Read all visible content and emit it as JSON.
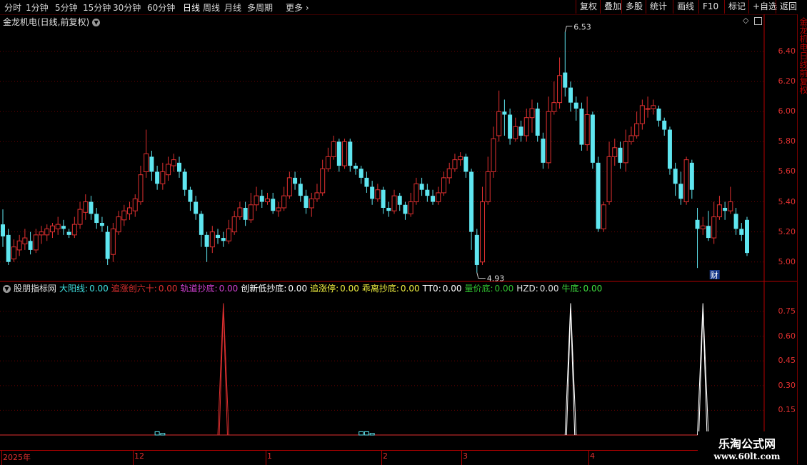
{
  "toolbar": {
    "timeframes": [
      "分时",
      "1分钟",
      "5分钟",
      "15分钟",
      "30分钟",
      "60分钟",
      "日线",
      "周线",
      "月线",
      "多周期",
      "更多"
    ],
    "active": "日线",
    "more_chevron": "chevron-right-icon",
    "right_buttons": [
      "复权",
      "叠加",
      "多股",
      "统计",
      "画线",
      "F10",
      "标记",
      "+自选",
      "返回"
    ]
  },
  "main": {
    "title": "金龙机电(日线,前复权)",
    "dropdown_icon": "chevron-down-icon",
    "diamond_icon": "diamond-icon",
    "panel_icon": "window-icon",
    "y_ticks": [
      "6.40",
      "6.20",
      "6.00",
      "5.80",
      "5.60",
      "5.40",
      "5.20",
      "5.00"
    ],
    "high_label": "6.53",
    "low_label": "4.93",
    "badge": "财"
  },
  "indicator": {
    "name": "股朋指标网",
    "items": [
      {
        "label": "大阳线:",
        "value": "0.00",
        "color": "#3fe0e0"
      },
      {
        "label": "追涨创六十:",
        "value": "0.00",
        "color": "#e03030"
      },
      {
        "label": "轨道抄底:",
        "value": "0.00",
        "color": "#d040d0"
      },
      {
        "label": "创新低抄底:",
        "value": "0.00",
        "color": "#ffffff"
      },
      {
        "label": "追涨停:",
        "value": "0.00",
        "color": "#f0f040"
      },
      {
        "label": "乖离抄底:",
        "value": "0.00",
        "color": "#f0f040"
      },
      {
        "label": "TT0:",
        "value": "0.00",
        "color": "#ffffff"
      },
      {
        "label": "量价底:",
        "value": "0.00",
        "color": "#30c030"
      },
      {
        "label": "HZD:",
        "value": "0.00",
        "color": "#e0e0e0"
      },
      {
        "label": "牛底:",
        "value": "0.00",
        "color": "#40e040"
      }
    ],
    "y_ticks": [
      "0.75",
      "0.60",
      "0.45",
      "0.30",
      "0.15"
    ]
  },
  "footer": {
    "dates": [
      "2025年",
      "12",
      "1",
      "2",
      "3",
      "4"
    ]
  },
  "watermark": {
    "line1": "乐淘公式网",
    "line2": "www.60lt.com"
  },
  "scroll_text": "金龙机电日线前复权",
  "chart_data": {
    "type": "candlestick",
    "ylim": [
      4.88,
      6.6
    ],
    "up_color": "#e03030",
    "down_color": "#5fe6f0",
    "candles": [
      [
        5.25,
        5.17,
        5.35,
        5.1
      ],
      [
        5.18,
        5.0,
        5.22,
        4.98
      ],
      [
        5.02,
        5.1,
        5.15,
        5.0
      ],
      [
        5.08,
        5.14,
        5.18,
        5.04
      ],
      [
        5.12,
        5.16,
        5.22,
        5.08
      ],
      [
        5.14,
        5.08,
        5.2,
        5.05
      ],
      [
        5.08,
        5.18,
        5.22,
        5.06
      ],
      [
        5.18,
        5.2,
        5.24,
        5.12
      ],
      [
        5.18,
        5.22,
        5.25,
        5.14
      ],
      [
        5.2,
        5.24,
        5.26,
        5.16
      ],
      [
        5.22,
        5.25,
        5.3,
        5.18
      ],
      [
        5.24,
        5.22,
        5.28,
        5.18
      ],
      [
        5.2,
        5.18,
        5.22,
        5.16
      ],
      [
        5.18,
        5.25,
        5.3,
        5.16
      ],
      [
        5.25,
        5.35,
        5.4,
        5.22
      ],
      [
        5.33,
        5.4,
        5.45,
        5.28
      ],
      [
        5.4,
        5.32,
        5.44,
        5.28
      ],
      [
        5.32,
        5.26,
        5.36,
        5.22
      ],
      [
        5.26,
        5.24,
        5.3,
        5.2
      ],
      [
        5.2,
        5.02,
        5.24,
        4.98
      ],
      [
        5.05,
        5.22,
        5.26,
        5.0
      ],
      [
        5.2,
        5.3,
        5.34,
        5.18
      ],
      [
        5.28,
        5.34,
        5.38,
        5.24
      ],
      [
        5.32,
        5.36,
        5.4,
        5.28
      ],
      [
        5.34,
        5.42,
        5.45,
        5.3
      ],
      [
        5.4,
        5.58,
        5.64,
        5.38
      ],
      [
        5.6,
        5.72,
        5.88,
        5.56
      ],
      [
        5.7,
        5.6,
        5.74,
        5.54
      ],
      [
        5.6,
        5.52,
        5.64,
        5.48
      ],
      [
        5.52,
        5.6,
        5.66,
        5.48
      ],
      [
        5.58,
        5.65,
        5.7,
        5.54
      ],
      [
        5.64,
        5.68,
        5.72,
        5.6
      ],
      [
        5.66,
        5.6,
        5.7,
        5.56
      ],
      [
        5.6,
        5.48,
        5.62,
        5.44
      ],
      [
        5.48,
        5.4,
        5.5,
        5.34
      ],
      [
        5.4,
        5.32,
        5.44,
        5.28
      ],
      [
        5.32,
        5.18,
        5.34,
        5.1
      ],
      [
        5.18,
        5.1,
        5.2,
        5.0
      ],
      [
        5.1,
        5.2,
        5.24,
        5.06
      ],
      [
        5.18,
        5.16,
        5.22,
        5.12
      ],
      [
        5.16,
        5.14,
        5.2,
        5.1
      ],
      [
        5.14,
        5.22,
        5.28,
        5.12
      ],
      [
        5.2,
        5.3,
        5.34,
        5.18
      ],
      [
        5.3,
        5.36,
        5.4,
        5.28
      ],
      [
        5.36,
        5.28,
        5.4,
        5.24
      ],
      [
        5.28,
        5.38,
        5.46,
        5.26
      ],
      [
        5.38,
        5.44,
        5.5,
        5.34
      ],
      [
        5.44,
        5.4,
        5.48,
        5.36
      ],
      [
        5.4,
        5.42,
        5.46,
        5.38
      ],
      [
        5.42,
        5.34,
        5.46,
        5.32
      ],
      [
        5.34,
        5.36,
        5.4,
        5.3
      ],
      [
        5.36,
        5.44,
        5.5,
        5.34
      ],
      [
        5.44,
        5.56,
        5.6,
        5.42
      ],
      [
        5.56,
        5.52,
        5.6,
        5.48
      ],
      [
        5.52,
        5.44,
        5.56,
        5.4
      ],
      [
        5.44,
        5.36,
        5.48,
        5.32
      ],
      [
        5.36,
        5.42,
        5.46,
        5.3
      ],
      [
        5.42,
        5.46,
        5.52,
        5.4
      ],
      [
        5.46,
        5.62,
        5.68,
        5.44
      ],
      [
        5.62,
        5.7,
        5.76,
        5.6
      ],
      [
        5.7,
        5.8,
        5.84,
        5.68
      ],
      [
        5.8,
        5.64,
        5.82,
        5.6
      ],
      [
        5.64,
        5.8,
        5.82,
        5.62
      ],
      [
        5.8,
        5.64,
        5.82,
        5.6
      ],
      [
        5.64,
        5.62,
        5.66,
        5.58
      ],
      [
        5.62,
        5.56,
        5.64,
        5.52
      ],
      [
        5.56,
        5.5,
        5.6,
        5.46
      ],
      [
        5.5,
        5.42,
        5.54,
        5.38
      ],
      [
        5.42,
        5.48,
        5.52,
        5.4
      ],
      [
        5.48,
        5.36,
        5.5,
        5.32
      ],
      [
        5.36,
        5.34,
        5.4,
        5.3
      ],
      [
        5.34,
        5.44,
        5.48,
        5.32
      ],
      [
        5.44,
        5.38,
        5.46,
        5.34
      ],
      [
        5.38,
        5.32,
        5.4,
        5.28
      ],
      [
        5.32,
        5.4,
        5.46,
        5.3
      ],
      [
        5.4,
        5.52,
        5.56,
        5.38
      ],
      [
        5.52,
        5.48,
        5.56,
        5.44
      ],
      [
        5.48,
        5.44,
        5.52,
        5.4
      ],
      [
        5.44,
        5.4,
        5.48,
        5.38
      ],
      [
        5.4,
        5.46,
        5.5,
        5.38
      ],
      [
        5.46,
        5.56,
        5.6,
        5.44
      ],
      [
        5.56,
        5.62,
        5.66,
        5.52
      ],
      [
        5.62,
        5.68,
        5.72,
        5.6
      ],
      [
        5.68,
        5.7,
        5.73,
        5.64
      ],
      [
        5.7,
        5.6,
        5.72,
        5.56
      ],
      [
        5.6,
        5.2,
        5.62,
        5.08
      ],
      [
        5.18,
        4.98,
        5.22,
        4.93
      ],
      [
        5.0,
        5.4,
        5.5,
        4.98
      ],
      [
        5.4,
        5.6,
        5.7,
        5.38
      ],
      [
        5.6,
        5.82,
        5.9,
        5.56
      ],
      [
        5.84,
        6.0,
        6.14,
        5.8
      ],
      [
        6.0,
        5.98,
        6.08,
        5.84
      ],
      [
        5.98,
        5.82,
        6.02,
        5.78
      ],
      [
        5.82,
        5.9,
        5.96,
        5.8
      ],
      [
        5.9,
        5.84,
        5.94,
        5.8
      ],
      [
        5.84,
        5.96,
        6.02,
        5.8
      ],
      [
        5.96,
        6.02,
        6.08,
        5.86
      ],
      [
        6.02,
        5.84,
        6.06,
        5.8
      ],
      [
        5.82,
        5.66,
        5.86,
        5.62
      ],
      [
        5.66,
        6.0,
        6.1,
        5.62
      ],
      [
        6.0,
        6.06,
        6.2,
        5.98
      ],
      [
        6.06,
        6.24,
        6.36,
        6.02
      ],
      [
        6.26,
        6.16,
        6.53,
        6.1
      ],
      [
        6.16,
        6.06,
        6.2,
        6.0
      ],
      [
        6.06,
        6.02,
        6.1,
        5.94
      ],
      [
        6.02,
        5.78,
        6.06,
        5.74
      ],
      [
        5.78,
        5.98,
        6.1,
        5.74
      ],
      [
        5.98,
        5.66,
        6.0,
        5.62
      ],
      [
        5.66,
        5.22,
        5.7,
        5.2
      ],
      [
        5.22,
        5.38,
        5.4,
        5.2
      ],
      [
        5.4,
        5.7,
        5.8,
        5.38
      ],
      [
        5.7,
        5.76,
        5.82,
        5.64
      ],
      [
        5.76,
        5.66,
        5.8,
        5.62
      ],
      [
        5.66,
        5.8,
        5.88,
        5.6
      ],
      [
        5.8,
        5.84,
        5.9,
        5.78
      ],
      [
        5.84,
        5.92,
        6.0,
        5.82
      ],
      [
        5.92,
        6.04,
        6.08,
        5.88
      ],
      [
        6.02,
        6.02,
        6.1,
        5.96
      ],
      [
        6.02,
        6.04,
        6.08,
        5.98
      ],
      [
        6.02,
        5.94,
        6.04,
        5.9
      ],
      [
        5.94,
        5.88,
        5.96,
        5.84
      ],
      [
        5.88,
        5.62,
        5.9,
        5.58
      ],
      [
        5.62,
        5.52,
        5.66,
        5.44
      ],
      [
        5.52,
        5.42,
        5.6,
        5.38
      ],
      [
        5.4,
        5.68,
        5.7,
        5.38
      ],
      [
        5.66,
        5.48,
        5.68,
        5.42
      ],
      [
        5.28,
        5.22,
        5.36,
        4.96
      ],
      [
        5.22,
        5.24,
        5.3,
        5.18
      ],
      [
        5.24,
        5.16,
        5.34,
        5.14
      ],
      [
        5.16,
        5.3,
        5.4,
        5.12
      ],
      [
        5.3,
        5.38,
        5.44,
        5.28
      ],
      [
        5.36,
        5.34,
        5.4,
        5.28
      ],
      [
        5.34,
        5.4,
        5.5,
        5.32
      ],
      [
        5.32,
        5.22,
        5.36,
        5.18
      ],
      [
        5.22,
        5.18,
        5.26,
        5.14
      ],
      [
        5.28,
        5.06,
        5.3,
        5.04
      ]
    ],
    "indicator_line": {
      "type": "line",
      "ylim": [
        0,
        0.85
      ],
      "peaks": [
        {
          "index": 40,
          "value": 0.8,
          "color": "#e03030"
        },
        {
          "index": 103,
          "value": 0.8,
          "color": "#ffffff"
        },
        {
          "index": 127,
          "value": 0.8,
          "color": "#ffffff"
        }
      ]
    },
    "volume_marks": [
      {
        "index": 28,
        "value": 0.02
      },
      {
        "index": 29,
        "value": 0.01
      },
      {
        "index": 65,
        "value": 0.02
      },
      {
        "index": 66,
        "value": 0.02
      },
      {
        "index": 67,
        "value": 0.01
      }
    ]
  }
}
